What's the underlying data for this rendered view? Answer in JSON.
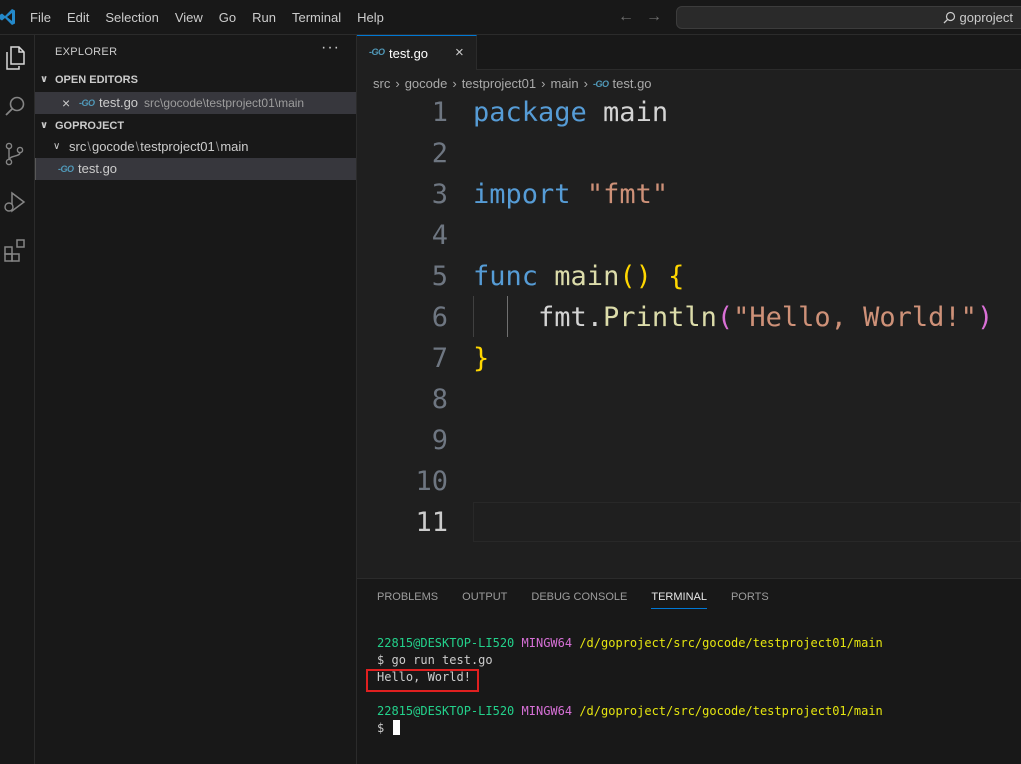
{
  "menu": [
    "File",
    "Edit",
    "Selection",
    "View",
    "Go",
    "Run",
    "Terminal",
    "Help"
  ],
  "command_center": {
    "label": "goproject"
  },
  "sidebar": {
    "title": "EXPLORER",
    "more": "···",
    "open_editors": {
      "header": "OPEN EDITORS",
      "items": [
        {
          "close": "×",
          "badge": "-GO",
          "name": "test.go",
          "path": "src\\gocode\\testproject01\\main"
        }
      ]
    },
    "project": {
      "header": "GOPROJECT",
      "folder": {
        "parts": [
          "src",
          "gocode",
          "testproject01",
          "main"
        ]
      },
      "file": {
        "badge": "-GO",
        "name": "test.go"
      }
    }
  },
  "editor": {
    "tab": {
      "badge": "-GO",
      "label": "test.go",
      "close": "×"
    },
    "breadcrumb": [
      "src",
      "gocode",
      "testproject01",
      "main",
      "test.go"
    ],
    "breadcrumb_sep": "›",
    "lines": [
      {
        "num": "1",
        "tokens": [
          [
            "kw",
            "package"
          ],
          [
            "plain",
            " main"
          ]
        ]
      },
      {
        "num": "2",
        "tokens": []
      },
      {
        "num": "3",
        "tokens": [
          [
            "kw",
            "import"
          ],
          [
            "plain",
            " "
          ],
          [
            "str",
            "\"fmt\""
          ]
        ]
      },
      {
        "num": "4",
        "tokens": []
      },
      {
        "num": "5",
        "tokens": [
          [
            "kw",
            "func"
          ],
          [
            "plain",
            " "
          ],
          [
            "fn",
            "main"
          ],
          [
            "br1",
            "()"
          ],
          [
            "plain",
            " "
          ],
          [
            "br1",
            "{"
          ]
        ]
      },
      {
        "num": "6",
        "tokens": [
          [
            "plain",
            "    fmt."
          ],
          [
            "fn",
            "Println"
          ],
          [
            "br2",
            "("
          ],
          [
            "str",
            "\"Hello, World!\""
          ],
          [
            "br2",
            ")"
          ]
        ]
      },
      {
        "num": "7",
        "tokens": [
          [
            "br1",
            "}"
          ]
        ]
      },
      {
        "num": "8",
        "tokens": []
      },
      {
        "num": "9",
        "tokens": []
      },
      {
        "num": "10",
        "tokens": []
      },
      {
        "num": "11",
        "tokens": []
      }
    ],
    "current_line": "11"
  },
  "panel": {
    "tabs": [
      "PROBLEMS",
      "OUTPUT",
      "DEBUG CONSOLE",
      "TERMINAL",
      "PORTS"
    ],
    "active_tab": "TERMINAL",
    "terminal": {
      "user": "22815@DESKTOP-LI520",
      "env": "MINGW64",
      "path": "/d/goproject/src/gocode/testproject01/main",
      "prompt": "$",
      "command": "go run test.go",
      "output": "Hello, World!",
      "highlight_color": "#e02020"
    }
  },
  "colors": {
    "accent": "#0078d4",
    "go_icon": "#519aba"
  }
}
